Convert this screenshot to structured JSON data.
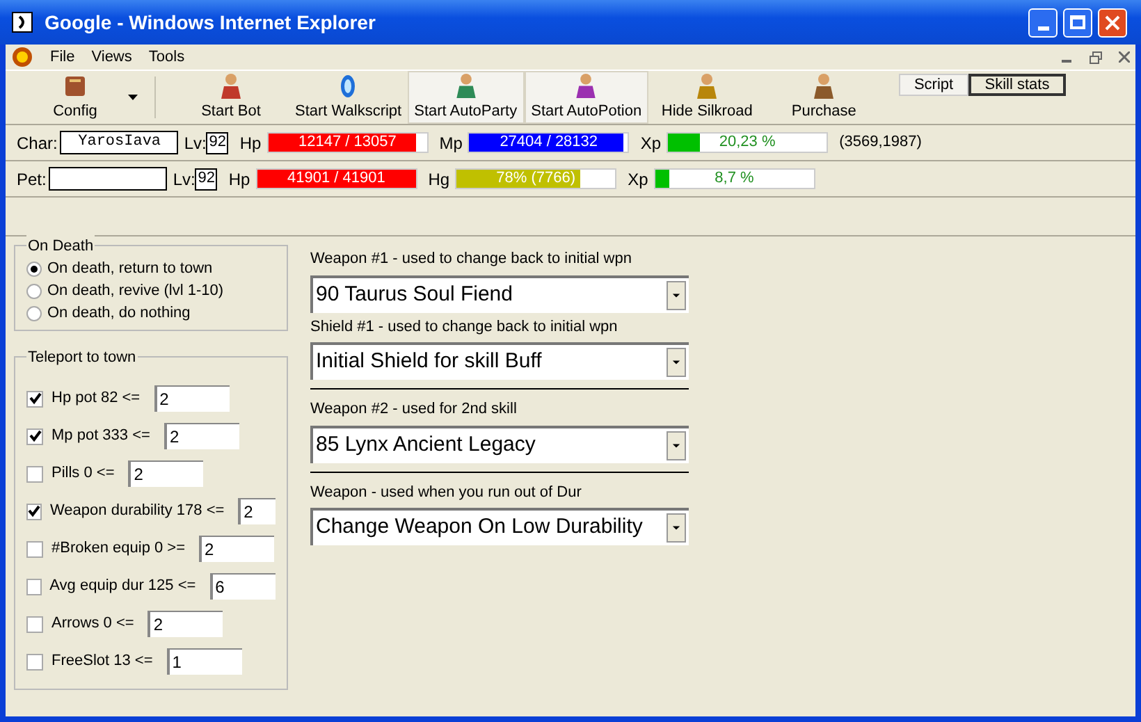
{
  "window": {
    "title": "Google - Windows Internet Explorer"
  },
  "menu": [
    "File",
    "Views",
    "Tools"
  ],
  "toolbar": [
    {
      "label": "Config",
      "pressed": false,
      "dropdown": true
    },
    {
      "label": "Start Bot",
      "pressed": false,
      "dropdown": false
    },
    {
      "label": "Start Walkscript",
      "pressed": false,
      "dropdown": false
    },
    {
      "label": "Start AutoParty",
      "pressed": true,
      "dropdown": false
    },
    {
      "label": "Start AutoPotion",
      "pressed": true,
      "dropdown": false
    },
    {
      "label": "Hide Silkroad",
      "pressed": false,
      "dropdown": false
    },
    {
      "label": "Purchase",
      "pressed": false,
      "dropdown": false
    }
  ],
  "tabs": [
    {
      "label": "Script",
      "selected": false
    },
    {
      "label": "Skill stats",
      "selected": true
    }
  ],
  "status_rows": [
    {
      "label": "Char:",
      "name": "YarosIava",
      "lv_label": "Lv:",
      "lv": "92",
      "coords": "(3569,1987)",
      "stats": [
        {
          "label": "Hp",
          "reading": "12147 / 13057",
          "level": 0.93,
          "color": "#ff0000"
        },
        {
          "label": "Mp",
          "reading": "27404 / 28132",
          "level": 0.97,
          "color": "#0000ff"
        },
        {
          "label": "Xp",
          "reading": "20,23 %",
          "level": 0.2,
          "color": "#00c000"
        }
      ]
    },
    {
      "label": "Pet:",
      "lv_label": "Lv:",
      "lv": "92",
      "stats": [
        {
          "label": "Hp",
          "reading": "41901 / 41901",
          "level": 1,
          "color": "#ff0000"
        },
        {
          "label": "Hg",
          "reading": "78% (7766)",
          "level": 0.78,
          "color": "#c0c000"
        },
        {
          "label": "Xp",
          "reading": "8,7 %",
          "level": 0.09,
          "color": "#00c000"
        }
      ]
    }
  ],
  "on_death": {
    "title": "On Death",
    "options": [
      {
        "label": "On death, return to town",
        "selected": true
      },
      {
        "label": "On death, revive (lvl 1-10)",
        "selected": false
      },
      {
        "label": "On death, do nothing",
        "selected": false
      }
    ]
  },
  "teleport": {
    "title": "Teleport to town",
    "items": [
      {
        "label": "Hp pot 82 <=",
        "checked": true,
        "value": "2"
      },
      {
        "label": "Mp pot 333 <=",
        "checked": true,
        "value": "2"
      },
      {
        "label": "Pills 0 <=",
        "checked": false,
        "value": "2"
      },
      {
        "label": "Weapon durability 178 <=",
        "checked": true,
        "value": "2"
      },
      {
        "label": "#Broken equip 0 >=",
        "checked": false,
        "value": "2"
      },
      {
        "label": "Avg equip dur 125 <=",
        "checked": false,
        "value": "6"
      },
      {
        "label": "Arrows 0 <=",
        "checked": false,
        "value": "2"
      },
      {
        "label": "FreeSlot 13 <=",
        "checked": false,
        "value": "1"
      }
    ]
  },
  "weapons": [
    {
      "label": "Weapon #1 - used to change back to initial wpn",
      "value": "90 Taurus Soul Fiend",
      "divider_above": false
    },
    {
      "label": "Shield #1 - used to change back to initial wpn",
      "value": "Initial Shield for skill Buff",
      "divider_above": false
    },
    {
      "label": "Weapon #2 - used for 2nd skill",
      "value": "85 Lynx Ancient Legacy",
      "divider_above": true
    },
    {
      "label": "Weapon - used when you run out of Dur",
      "value": "Change Weapon On Low Durability",
      "divider_above": true
    }
  ]
}
